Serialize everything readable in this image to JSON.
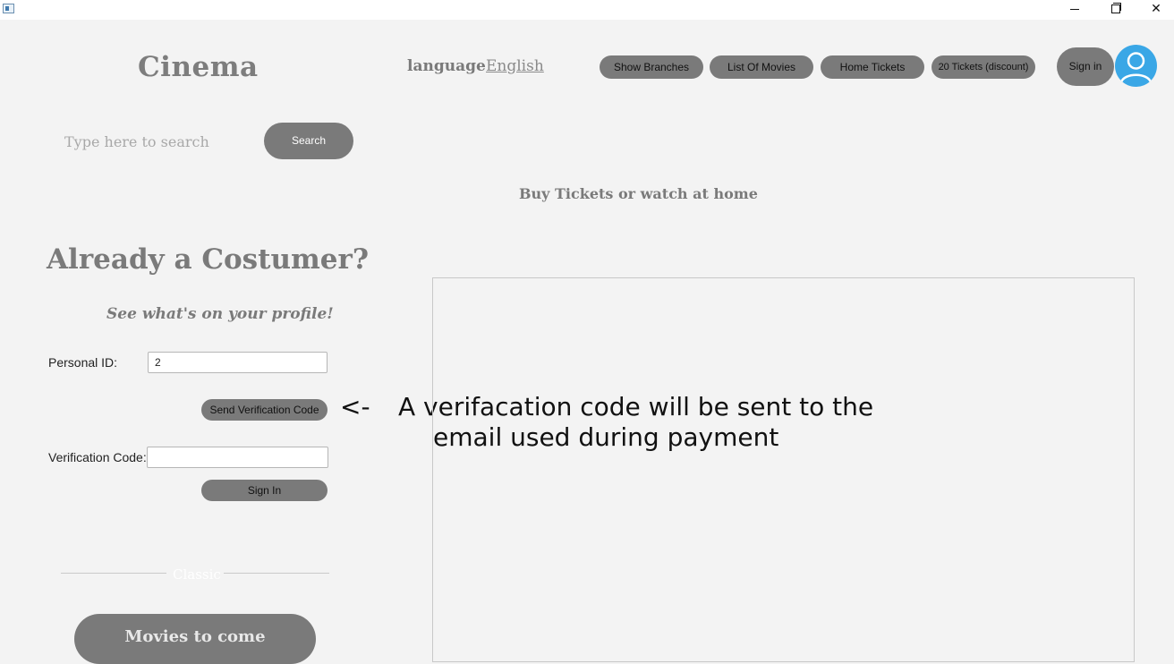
{
  "window": {
    "minimize_glyph": "",
    "maximize_glyph": "",
    "close_glyph": "✕"
  },
  "header": {
    "brand": "Cinema",
    "language_label": "language",
    "language_value": "English",
    "nav": [
      {
        "label": "Show Branches"
      },
      {
        "label": "List Of Movies"
      },
      {
        "label": "Home Tickets"
      },
      {
        "label": "20 Tickets (discount)"
      }
    ],
    "sign_in_label": "Sign in",
    "avatar_icon": "user-icon"
  },
  "search": {
    "placeholder": "Type here to search",
    "button_label": "Search"
  },
  "tagline": "Buy Tickets or watch at home",
  "login": {
    "heading": "Already a Costumer?",
    "subheading": "See what's on your profile!",
    "personal_id_label": "Personal ID:",
    "personal_id_value": "2",
    "send_code_label": "Send Verification Code",
    "arrow": "<-",
    "note_line1": "A verifacation code will be sent to the",
    "note_line2": "email used during payment",
    "verification_label": "Verification Code:",
    "verification_value": "",
    "sign_in_label": "Sign In"
  },
  "section": {
    "classic_label": "Classic",
    "movies_to_come_label": "Movies to come"
  },
  "colors": {
    "background": "#f3f3f3",
    "button": "#7a7a7a",
    "avatar": "#3aa7e6"
  }
}
